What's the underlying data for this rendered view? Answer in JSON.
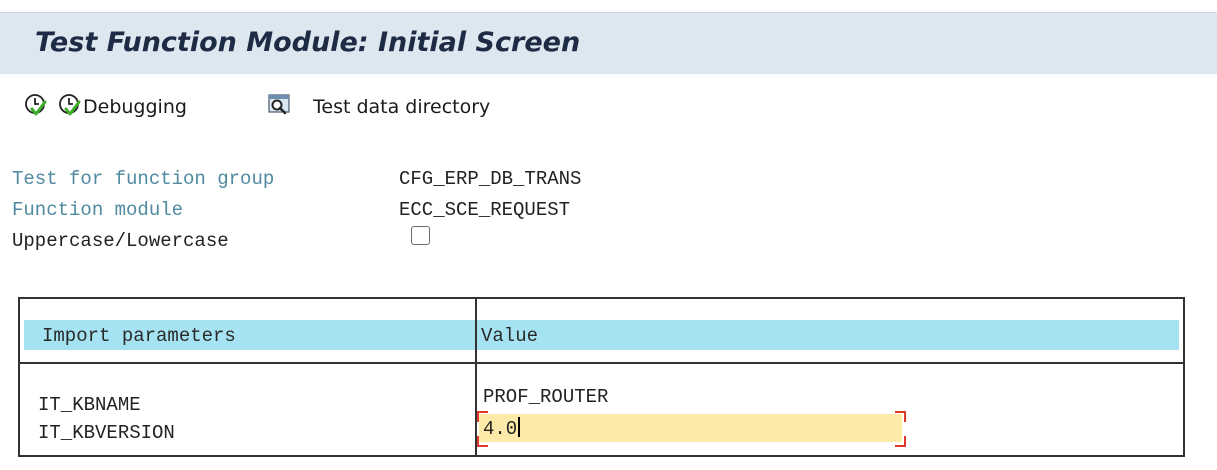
{
  "window": {
    "title": "Test Function Module: Initial Screen"
  },
  "toolbar": {
    "execute_icon": "execute-clock-icon",
    "debugging_icon": "execute-debug-icon",
    "debugging_label": "Debugging",
    "test_data_icon": "test-data-directory-icon",
    "test_data_label": "Test data directory"
  },
  "header_info": {
    "function_group_label": "Test for function group",
    "function_group_value": "CFG_ERP_DB_TRANS",
    "function_module_label": "Function module",
    "function_module_value": "ECC_SCE_REQUEST",
    "uppercase_label": "Uppercase/Lowercase",
    "uppercase_checked": false
  },
  "params_table": {
    "col_param": "Import parameters",
    "col_value": "Value",
    "rows": [
      {
        "name": "IT_KBNAME",
        "value": "PROF_ROUTER"
      },
      {
        "name": "IT_KBVERSION",
        "value": "4.0"
      }
    ]
  },
  "colors": {
    "title_bar_bg": "#dde7f0",
    "header_row_bg": "#a5e3f2",
    "label_color": "#4f8aa0",
    "focus_field_bg": "#fdeaa8",
    "focus_corner": "#e0382f"
  }
}
